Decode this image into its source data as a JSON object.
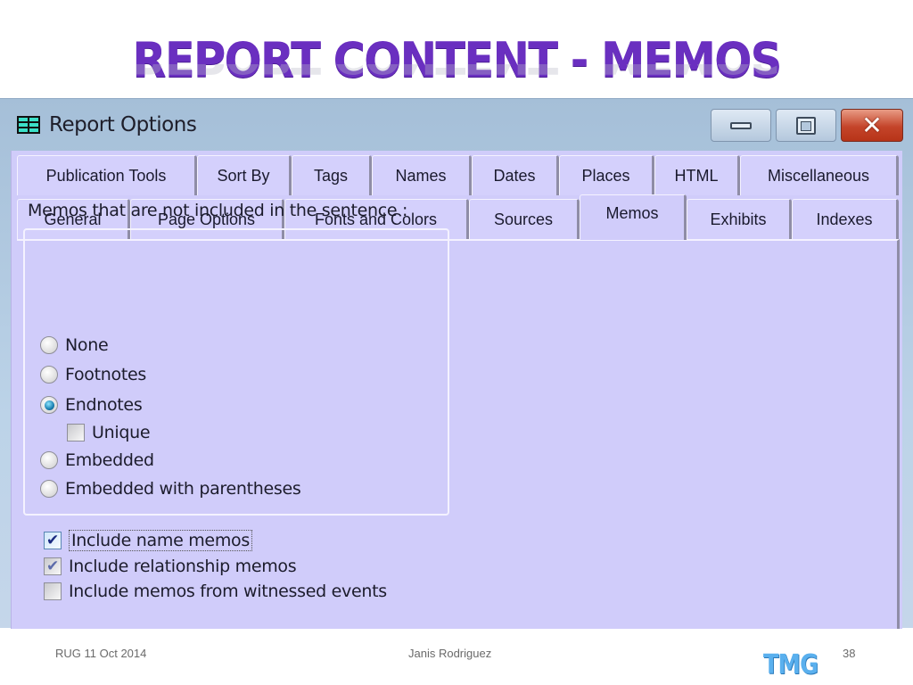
{
  "slide": {
    "title": "REPORT CONTENT - MEMOS",
    "footer_left": "RUG 11 Oct 2014",
    "footer_center": "Janis Rodriguez",
    "page_number": "38",
    "logo_text": "TMG"
  },
  "window": {
    "title": "Report Options",
    "icon": "report-grid-icon",
    "controls": {
      "minimize": "minimize-icon",
      "maximize": "maximize-icon",
      "close": "close-icon",
      "close_glyph": "✕"
    }
  },
  "tabs": {
    "row1": [
      {
        "label": "Publication Tools"
      },
      {
        "label": "Sort By"
      },
      {
        "label": "Tags"
      },
      {
        "label": "Names"
      },
      {
        "label": "Dates"
      },
      {
        "label": "Places"
      },
      {
        "label": "HTML"
      },
      {
        "label": "Miscellaneous"
      }
    ],
    "row2": [
      {
        "label": "General"
      },
      {
        "label": "Page Options"
      },
      {
        "label": "Fonts and Colors"
      },
      {
        "label": "Sources"
      },
      {
        "label": "Memos",
        "active": true
      },
      {
        "label": "Exhibits"
      },
      {
        "label": "Indexes"
      }
    ]
  },
  "memos": {
    "group_label": "Memos that are not included in the sentence :",
    "radio_options": [
      {
        "label": "None",
        "selected": false
      },
      {
        "label": "Footnotes",
        "selected": false
      },
      {
        "label": "Endnotes",
        "selected": true
      },
      {
        "label": "Embedded",
        "selected": false
      },
      {
        "label": "Embedded with parentheses",
        "selected": false
      }
    ],
    "unique": {
      "label": "Unique",
      "checked": false
    },
    "checkboxes": [
      {
        "label": "Include name memos",
        "checked": true,
        "focused": true
      },
      {
        "label": "Include relationship memos",
        "checked": true
      },
      {
        "label": "Include memos from witnessed events",
        "checked": false
      }
    ],
    "check_glyph": "✔"
  },
  "colors": {
    "title_purple": "#6a2fc0",
    "panel_lavender": "#d0ccfa",
    "titlebar_blue": "#a5bfd8",
    "close_red": "#c4442a",
    "logo_blue": "#5ab0ee"
  }
}
